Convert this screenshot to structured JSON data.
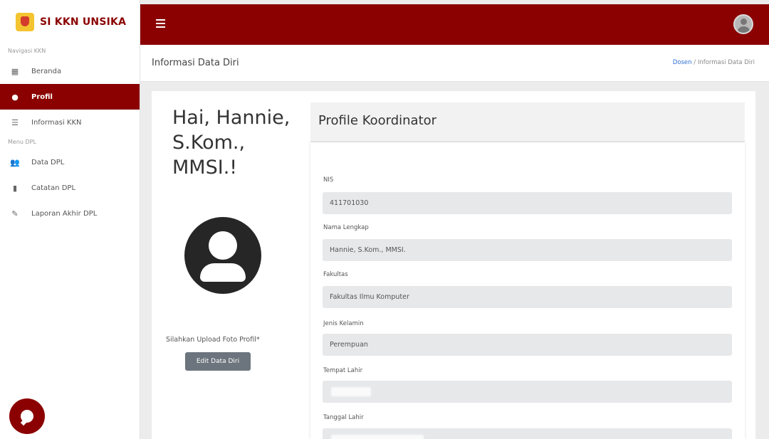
{
  "sidebar": {
    "brand": "SI KKN UNSIKA",
    "section_nav": "Navigasi KKN",
    "section_menu": "Menu DPL",
    "items": [
      {
        "label": "Beranda",
        "icon": "dashboard-icon"
      },
      {
        "label": "Profil",
        "icon": "user-icon",
        "active": true
      },
      {
        "label": "Informasi KKN",
        "icon": "table-icon"
      },
      {
        "label": "Data DPL",
        "icon": "users-icon"
      },
      {
        "label": "Catatan DPL",
        "icon": "file-icon"
      },
      {
        "label": "Laporan Akhir DPL",
        "icon": "edit-icon"
      }
    ]
  },
  "topbar": {
    "accent": "#8b0000"
  },
  "pagebar": {
    "title": "Informasi Data Diri",
    "breadcrumb_link": "Dosen",
    "breadcrumb_sep": "/",
    "breadcrumb_current": "Informasi Data Diri"
  },
  "profile": {
    "greeting": "Hai, Hannie, S.Kom., MMSI.!",
    "upload_note": "Silahkan Upload Foto Profil*",
    "edit_button": "Edit Data Diri",
    "card_title": "Profile Koordinator",
    "fields": [
      {
        "label": "NIS",
        "value": "411701030"
      },
      {
        "label": "Nama Lengkap",
        "value": "Hannie, S.Kom., MMSI."
      },
      {
        "label": "Fakultas",
        "value": "Fakultas Ilmu Komputer"
      },
      {
        "label": "Jenis Kelamin",
        "value": "Perempuan"
      },
      {
        "label": "Tempat Lahir",
        "value": ""
      },
      {
        "label": "Tanggal Lahir",
        "value": ""
      }
    ]
  }
}
